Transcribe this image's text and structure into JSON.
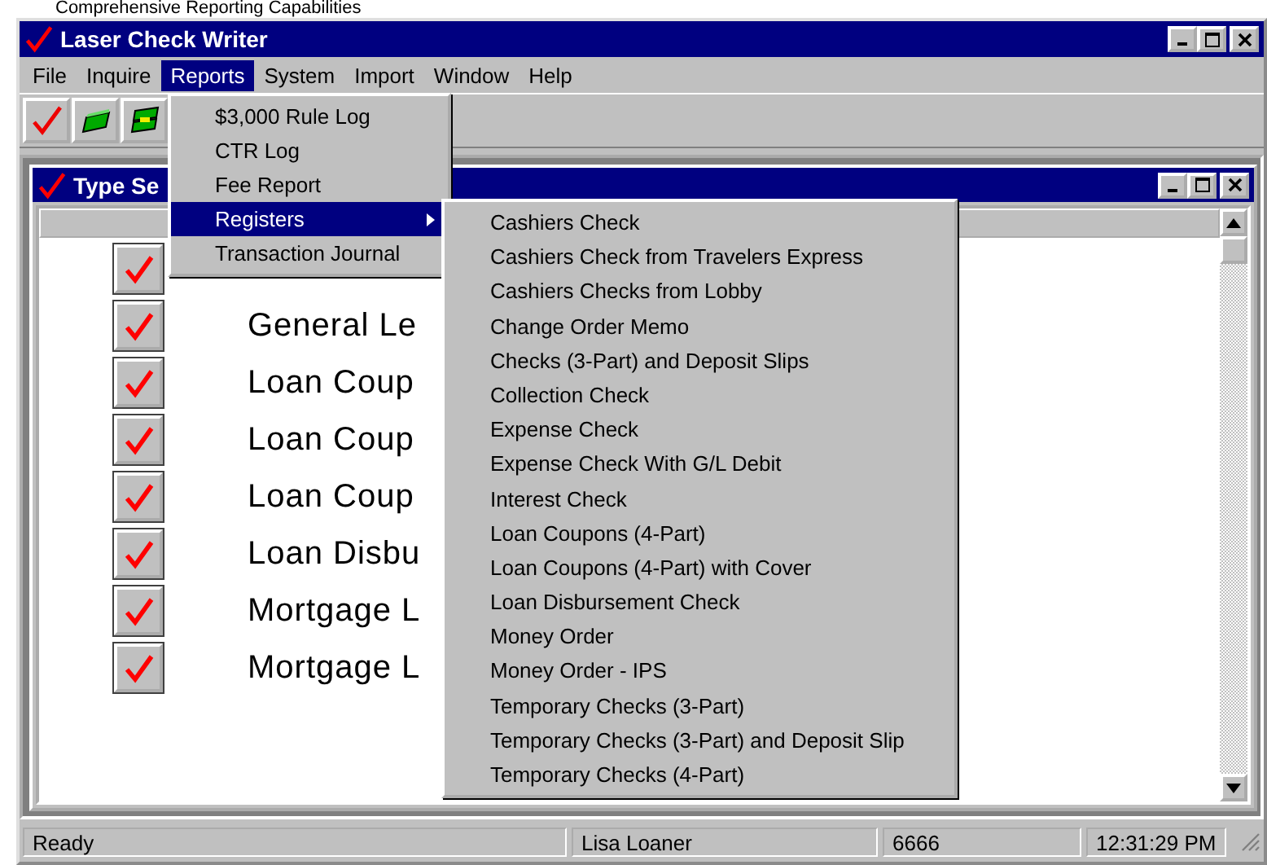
{
  "caption": "Comprehensive Reporting Capabilities",
  "window": {
    "title": "Laser Check Writer"
  },
  "menubar": [
    {
      "label": "File",
      "selected": false
    },
    {
      "label": "Inquire",
      "selected": false
    },
    {
      "label": "Reports",
      "selected": true
    },
    {
      "label": "System",
      "selected": false
    },
    {
      "label": "Import",
      "selected": false
    },
    {
      "label": "Window",
      "selected": false
    },
    {
      "label": "Help",
      "selected": false
    }
  ],
  "toolbar": [
    {
      "kind": "check"
    },
    {
      "kind": "money"
    },
    {
      "kind": "money-stack"
    }
  ],
  "child_window": {
    "title": "Type Se",
    "rows": [
      {},
      {
        "label": "General Le"
      },
      {
        "label": "Loan Coup"
      },
      {
        "label": "Loan Coup"
      },
      {
        "label": "Loan Coup"
      },
      {
        "label": "Loan Disbu"
      },
      {
        "label": "Mortgage L"
      },
      {
        "label": "Mortgage L"
      }
    ]
  },
  "reports_menu": [
    {
      "label": "$3,000 Rule Log",
      "selected": false,
      "submenu": false
    },
    {
      "label": "CTR Log",
      "selected": false,
      "submenu": false
    },
    {
      "label": "Fee Report",
      "selected": false,
      "submenu": false
    },
    {
      "label": "Registers",
      "selected": true,
      "submenu": true
    },
    {
      "label": "Transaction Journal",
      "selected": false,
      "submenu": false
    }
  ],
  "registers_menu": [
    "Cashiers Check",
    "Cashiers Check from Travelers Express",
    "Cashiers Checks from Lobby",
    "Change Order Memo",
    "Checks (3-Part) and Deposit Slips",
    "Collection Check",
    "Expense Check",
    "Expense Check With G/L Debit",
    "Interest Check",
    "Loan Coupons (4-Part)",
    "Loan Coupons (4-Part) with Cover",
    "Loan Disbursement Check",
    "Money Order",
    "Money Order - IPS",
    "Temporary Checks (3-Part)",
    "Temporary Checks (3-Part) and Deposit Slip",
    "Temporary Checks (4-Part)"
  ],
  "status_bar": [
    "Ready",
    "Lisa Loaner",
    "6666",
    "12:31:29 PM"
  ]
}
